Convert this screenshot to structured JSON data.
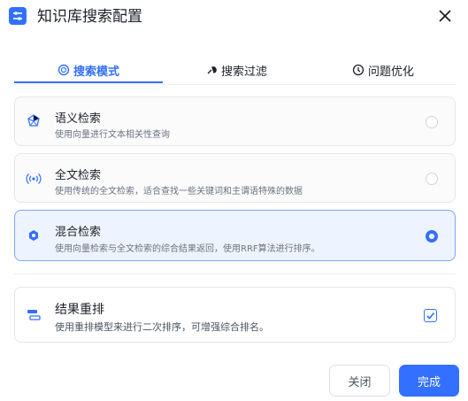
{
  "dialog": {
    "title": "知识库搜索配置"
  },
  "tabs": [
    {
      "label": "搜索模式",
      "icon": "search-mode-icon",
      "active": true
    },
    {
      "label": "搜索过滤",
      "icon": "filter-icon",
      "active": false
    },
    {
      "label": "问题优化",
      "icon": "optimize-icon",
      "active": false
    }
  ],
  "modes": [
    {
      "title": "语义检索",
      "desc": "使用向量进行文本相关性查询",
      "icon": "semantic-icon",
      "selected": false
    },
    {
      "title": "全文检索",
      "desc": "使用传统的全文检索，适合查找一些关键词和主谓语特殊的数据",
      "icon": "fulltext-icon",
      "selected": false
    },
    {
      "title": "混合检索",
      "desc": "使用向量检索与全文检索的综合结果返回，使用RRF算法进行排序。",
      "icon": "hybrid-icon",
      "selected": true
    }
  ],
  "rerank": {
    "title": "结果重排",
    "desc": "使用重排模型来进行二次排序，可增强综合排名。",
    "checked": true
  },
  "footer": {
    "cancel_label": "关闭",
    "confirm_label": "完成"
  },
  "colors": {
    "accent": "#3370ff",
    "selected_bg": "#eef4ff"
  }
}
